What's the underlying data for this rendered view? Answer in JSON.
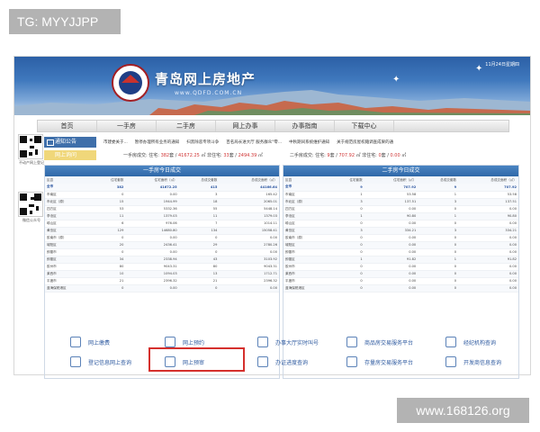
{
  "overlay": {
    "tg": "TG: MYYJJPP",
    "site": "www.168126.org"
  },
  "banner": {
    "title": "青岛网上房地产",
    "sub": "www.QDFD.COM.CN",
    "date": "11月24日星期四"
  },
  "nav": [
    "首页",
    "一手房",
    "二手房",
    "网上办事",
    "办事指南",
    "下载中心"
  ],
  "qr": {
    "cap1": "不动产网上登记",
    "cap2": "微信公众号"
  },
  "notice": {
    "label": "通知公告",
    "items": [
      "市建委关于...",
      "暂停办理所有业务的通知",
      "扫黑除恶专项斗争",
      "百名局长进大厅 服务群众\"零...",
      "中秋期间系统维护通知",
      "关于规范房屋权籍调查成果的通"
    ]
  },
  "online": {
    "label": "网上询问"
  },
  "stats": {
    "a": {
      "pre": "一手房成交: 住宅: ",
      "num1": "382",
      "unit1": "套",
      "sep": " / ",
      "num2": "41672.25",
      "unit2": " ㎡ 非住宅: ",
      "num3": "33",
      "unit3": "套",
      "num4": "2494.39",
      "unit4": " ㎡"
    },
    "b": {
      "pre": "二手房成交: 住宅: ",
      "num1": "9",
      "unit1": "套",
      "num2": "707.92",
      "unit2": " ㎡ 非住宅: ",
      "num3": "0",
      "unit3": "套",
      "num4": "0.00",
      "unit4": " ㎡"
    }
  },
  "left_table": {
    "title": "一手房今日成交",
    "headers": [
      "区县",
      "住宅套数",
      "住宅面积（㎡）",
      "总成交套数",
      "总成交面积（㎡）"
    ],
    "rows": [
      [
        "全市",
        "382",
        "41672.25",
        "415",
        "44166.64"
      ],
      [
        "市南区",
        "0",
        "0.00",
        "3",
        "165.42"
      ],
      [
        "市北区（原）",
        "15",
        "1944.99",
        "18",
        "2065.01"
      ],
      [
        "四方区",
        "53",
        "5332.36",
        "55",
        "5448.14"
      ],
      [
        "李沧区",
        "11",
        "1379.03",
        "11",
        "1379.03"
      ],
      [
        "崂山区",
        "6",
        "976.06",
        "7",
        "1014.11"
      ],
      [
        "黄岛区",
        "129",
        "14680.80",
        "134",
        "15058.41"
      ],
      [
        "胶南市（原）",
        "0",
        "0.00",
        "0",
        "0.00"
      ],
      [
        "城阳区",
        "20",
        "2436.41",
        "29",
        "2780.26"
      ],
      [
        "即墨市",
        "0",
        "0.00",
        "0",
        "0.00"
      ],
      [
        "即墨区",
        "34",
        "2338.94",
        "43",
        "3103.92"
      ],
      [
        "胶州市",
        "80",
        "9043.31",
        "80",
        "9043.31"
      ],
      [
        "莱西市",
        "10",
        "1094.03",
        "13",
        "1712.71"
      ],
      [
        "平度市",
        "21",
        "2396.32",
        "21",
        "2396.32"
      ],
      [
        "蓝海保税港区",
        "0",
        "0.00",
        "0",
        "0.00"
      ]
    ]
  },
  "right_table": {
    "title": "二手房今日成交",
    "headers": [
      "区县",
      "住宅套数",
      "住宅面积（㎡）",
      "总成交套数",
      "总成交面积（㎡）"
    ],
    "rows": [
      [
        "全市",
        "9",
        "707.92",
        "9",
        "707.92"
      ],
      [
        "市南区",
        "1",
        "53.58",
        "1",
        "53.58"
      ],
      [
        "市北区（原）",
        "3",
        "137.51",
        "3",
        "137.51"
      ],
      [
        "四方区",
        "0",
        "0.00",
        "0",
        "0.00"
      ],
      [
        "李沧区",
        "1",
        "90.80",
        "1",
        "90.80"
      ],
      [
        "崂山区",
        "0",
        "0.00",
        "0",
        "0.00"
      ],
      [
        "黄岛区",
        "3",
        "334.21",
        "3",
        "334.21"
      ],
      [
        "胶南市（原）",
        "0",
        "0.00",
        "0",
        "0.00"
      ],
      [
        "城阳区",
        "0",
        "0.00",
        "0",
        "0.00"
      ],
      [
        "即墨市",
        "0",
        "0.00",
        "0",
        "0.00"
      ],
      [
        "即墨区",
        "1",
        "91.82",
        "1",
        "91.82"
      ],
      [
        "胶州市",
        "0",
        "0.00",
        "0",
        "0.00"
      ],
      [
        "莱西市",
        "0",
        "0.00",
        "0",
        "0.00"
      ],
      [
        "平度市",
        "0",
        "0.00",
        "0",
        "0.00"
      ],
      [
        "蓝海保税港区",
        "0",
        "0.00",
        "0",
        "0.00"
      ]
    ]
  },
  "links": [
    {
      "label": "网上缴费",
      "icon": "monitor-icon"
    },
    {
      "label": "网上预约",
      "icon": "calendar-icon"
    },
    {
      "label": "办事大厅实时叫号",
      "icon": "speech-bubble-icon"
    },
    {
      "label": "商品房交易服务平台",
      "icon": "building-icon"
    },
    {
      "label": "经纪机构查询",
      "icon": "person-check-icon"
    },
    {
      "label": "登记信息网上查询",
      "icon": "search-icon"
    },
    {
      "label": "网上预审",
      "icon": "user-icon"
    },
    {
      "label": "办证进度查询",
      "icon": "share-icon"
    },
    {
      "label": "存量房交易服务平台",
      "icon": "house-icon"
    },
    {
      "label": "开发商信息查询",
      "icon": "grid-icon"
    }
  ]
}
